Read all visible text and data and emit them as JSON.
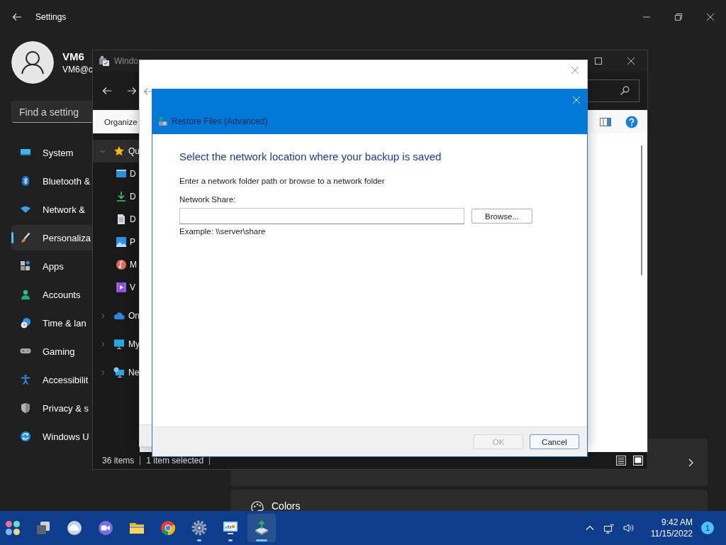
{
  "settings": {
    "title": "Settings",
    "user": {
      "name": "VM6",
      "email": "VM6@c"
    },
    "search": {
      "placeholder": "Find a setting"
    },
    "nav": [
      {
        "label": "System",
        "kind": "system",
        "selected": false
      },
      {
        "label": "Bluetooth &",
        "kind": "bluetooth",
        "selected": false
      },
      {
        "label": "Network &",
        "kind": "network",
        "selected": false
      },
      {
        "label": "Personaliza",
        "kind": "personalization",
        "selected": true
      },
      {
        "label": "Apps",
        "kind": "apps",
        "selected": false
      },
      {
        "label": "Accounts",
        "kind": "accounts",
        "selected": false
      },
      {
        "label": "Time & lan",
        "kind": "time",
        "selected": false
      },
      {
        "label": "Gaming",
        "kind": "gaming",
        "selected": false
      },
      {
        "label": "Accessibilit",
        "kind": "accessibility",
        "selected": false
      },
      {
        "label": "Privacy & s",
        "kind": "privacy",
        "selected": false
      },
      {
        "label": "Windows U",
        "kind": "update",
        "selected": false
      }
    ],
    "cards": [
      {
        "kind": "chevron"
      },
      {
        "kind": "palette",
        "title": "Colors"
      }
    ]
  },
  "explorer": {
    "title": "Windo",
    "command": "Organize",
    "tree": [
      {
        "label": "Qu",
        "kind": "star",
        "expanded": true,
        "selected": true,
        "children": [
          {
            "label": "D",
            "kind": "desktop",
            "selected": false
          },
          {
            "label": "D",
            "kind": "download",
            "selected": false
          },
          {
            "label": "D",
            "kind": "document",
            "selected": false
          },
          {
            "label": "P",
            "kind": "pictures",
            "selected": false
          },
          {
            "label": "M",
            "kind": "music",
            "selected": false
          },
          {
            "label": "V",
            "kind": "videos",
            "selected": false
          }
        ]
      },
      {
        "label": "On",
        "kind": "cloud",
        "expanded": false,
        "selected": false
      },
      {
        "label": "My",
        "kind": "pc",
        "expanded": false,
        "selected": false
      },
      {
        "label": "Ne",
        "kind": "netpc",
        "expanded": false,
        "selected": false
      }
    ],
    "status": [
      "36 items",
      "1 item selected"
    ]
  },
  "dialog": {
    "title": "Restore Files (Advanced)",
    "heading": "Select the network location where your backup is saved",
    "instruction": "Enter a network folder path or browse to a network folder",
    "field_label": "Network Share:",
    "browse": "Browse...",
    "example": "Example: \\\\server\\share",
    "buttons": [
      {
        "label": "OK",
        "disabled": true
      },
      {
        "label": "Cancel",
        "disabled": false
      }
    ]
  },
  "taskbar": {
    "apps": [
      {
        "kind": "start",
        "running": false,
        "active": false
      },
      {
        "kind": "taskview",
        "running": false,
        "active": false
      },
      {
        "kind": "widgets",
        "running": false,
        "active": false
      },
      {
        "kind": "chat",
        "running": false,
        "active": false
      },
      {
        "kind": "explorer",
        "running": false,
        "active": false
      },
      {
        "kind": "browser",
        "running": false,
        "active": false
      },
      {
        "kind": "settings",
        "running": true,
        "active": false
      },
      {
        "kind": "control",
        "running": true,
        "active": false
      },
      {
        "kind": "backup",
        "running": true,
        "active": true
      }
    ],
    "tray": [
      {
        "kind": "chevron"
      },
      {
        "kind": "network"
      },
      {
        "kind": "volume"
      }
    ],
    "time": "9:42 AM",
    "date": "11/15/2022",
    "badge": "1"
  }
}
